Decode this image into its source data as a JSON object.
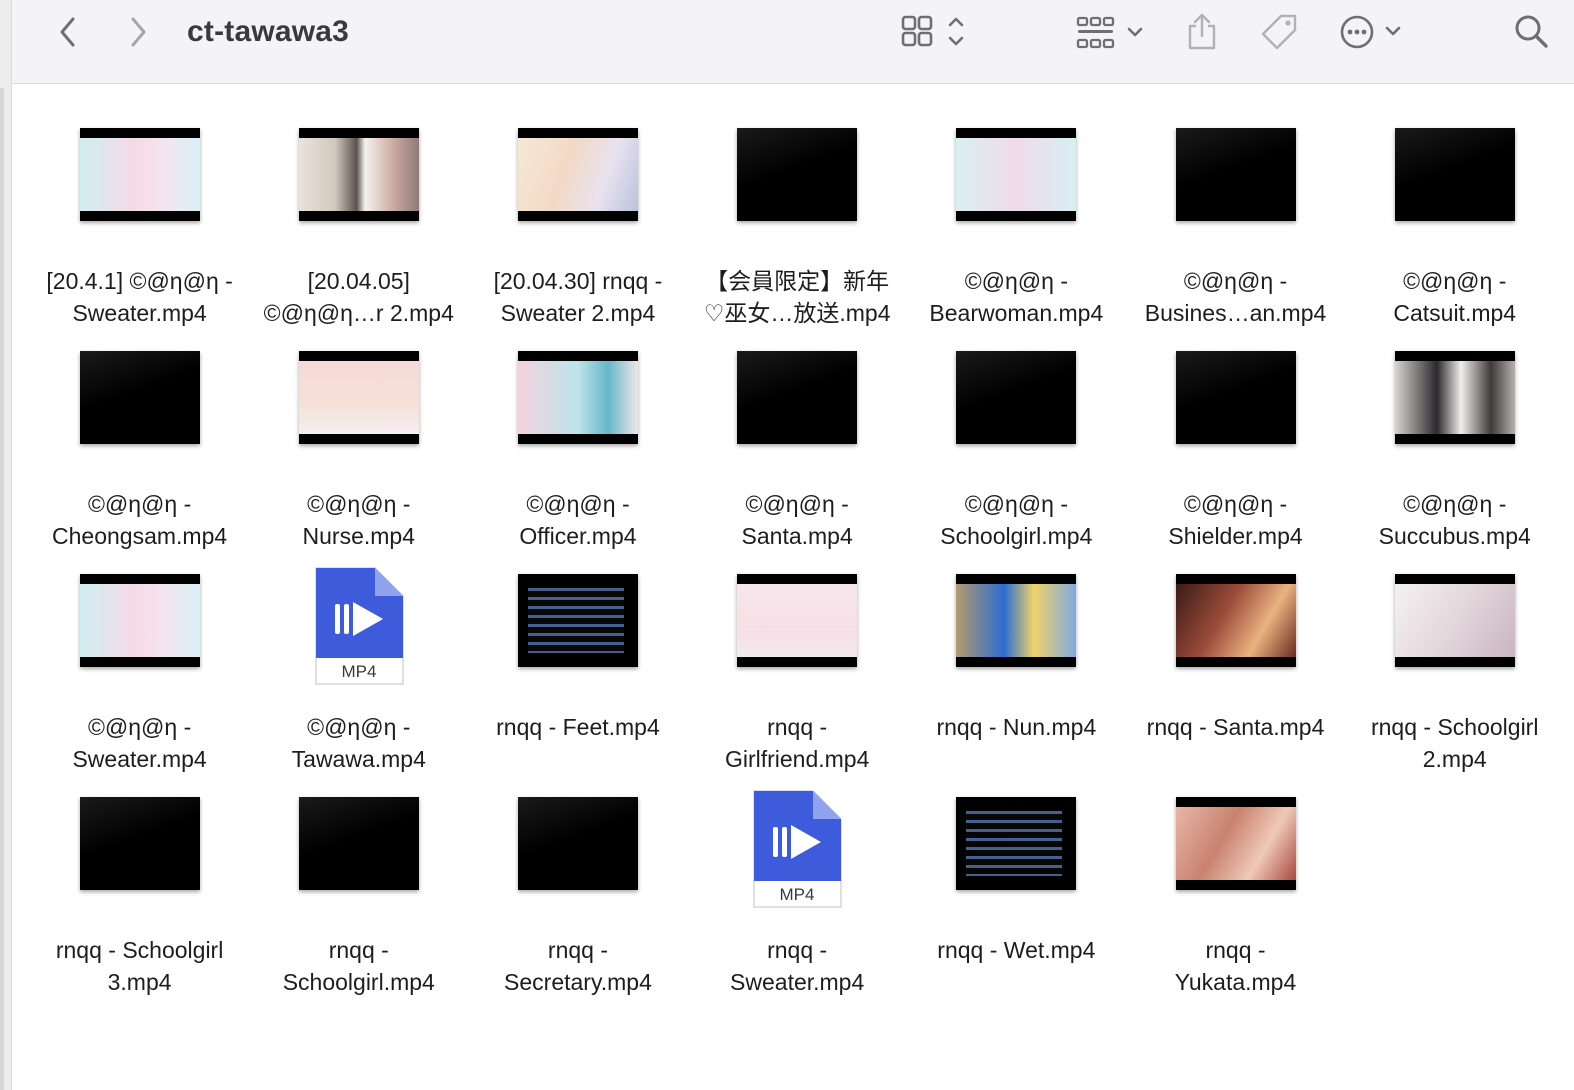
{
  "window": {
    "title": "ct-tawawa3"
  },
  "toolbar": {
    "back": "chevron-left-icon",
    "forward": "chevron-right-icon",
    "view": "icon-view-icon",
    "group": "group-by-icon",
    "share": "share-icon",
    "tags": "tag-icon",
    "more": "ellipsis-circle-icon",
    "search": "search-icon"
  },
  "files": [
    {
      "name": "[20.4.1] ©@η@η -\nSweater.mp4",
      "thumb": "pastel-banner"
    },
    {
      "name": "[20.04.05]\n©@η@η…r 2.mp4",
      "thumb": "photo-collage"
    },
    {
      "name": "[20.04.30] rnqq -\nSweater 2.mp4",
      "thumb": "anime-blonde"
    },
    {
      "name": "【会員限定】新年\n♡巫女…放送.mp4",
      "thumb": "black"
    },
    {
      "name": "©@η@η -\nBearwoman.mp4",
      "thumb": "pastel-archive"
    },
    {
      "name": "©@η@η -\nBusines…an.mp4",
      "thumb": "black"
    },
    {
      "name": "©@η@η -\nCatsuit.mp4",
      "thumb": "black"
    },
    {
      "name": "©@η@η -\nCheongsam.mp4",
      "thumb": "black"
    },
    {
      "name": "©@η@η -\nNurse.mp4",
      "thumb": "pink-archive"
    },
    {
      "name": "©@η@η -\nOfficer.mp4",
      "thumb": "anime-teal"
    },
    {
      "name": "©@η@η -\nSanta.mp4",
      "thumb": "black"
    },
    {
      "name": "©@η@η -\nSchoolgirl.mp4",
      "thumb": "black"
    },
    {
      "name": "©@η@η -\nShielder.mp4",
      "thumb": "black"
    },
    {
      "name": "©@η@η -\nSuccubus.mp4",
      "thumb": "photo-dark"
    },
    {
      "name": "©@η@η -\nSweater.mp4",
      "thumb": "pastel-banner"
    },
    {
      "name": "©@η@η -\nTawawa.mp4",
      "thumb": "mp4-doc"
    },
    {
      "name": "rnqq - Feet.mp4",
      "thumb": "text-dark"
    },
    {
      "name": "rnqq -\nGirlfriend.mp4",
      "thumb": "pink-text"
    },
    {
      "name": "rnqq - Nun.mp4",
      "thumb": "photo-blue"
    },
    {
      "name": "rnqq - Santa.mp4",
      "thumb": "photo-red"
    },
    {
      "name": "rnqq - Schoolgirl\n2.mp4",
      "thumb": "photo-light"
    },
    {
      "name": "rnqq - Schoolgirl\n3.mp4",
      "thumb": "black"
    },
    {
      "name": "rnqq -\nSchoolgirl.mp4",
      "thumb": "black"
    },
    {
      "name": "rnqq -\nSecretary.mp4",
      "thumb": "black"
    },
    {
      "name": "rnqq -\nSweater.mp4",
      "thumb": "mp4-doc"
    },
    {
      "name": "rnqq - Wet.mp4",
      "thumb": "text-dark2"
    },
    {
      "name": "rnqq -\nYukata.mp4",
      "thumb": "photo-skin"
    }
  ],
  "mp4_badge": "MP4",
  "colors": {
    "toolbar_bg": "#f4f4f6",
    "icon_gray": "#6e6e73",
    "doc_blue": "#3d5bdb"
  }
}
